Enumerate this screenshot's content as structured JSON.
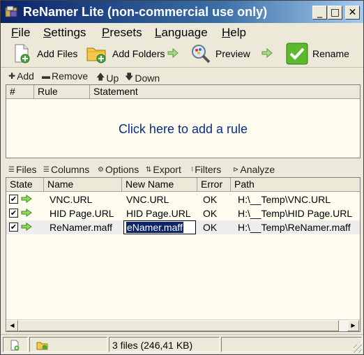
{
  "window": {
    "title": "ReNamer Lite (non-commercial use only)"
  },
  "menu": [
    "File",
    "Settings",
    "Presets",
    "Language",
    "Help"
  ],
  "menu_underline": [
    "F",
    "S",
    "P",
    "L",
    "H"
  ],
  "toolbar": {
    "add_files": "Add Files",
    "add_folders": "Add Folders",
    "preview": "Preview",
    "rename": "Rename"
  },
  "rules_toolbar": {
    "add": "Add",
    "remove": "Remove",
    "up": "Up",
    "down": "Down"
  },
  "rules_table": {
    "columns": [
      "#",
      "Rule",
      "Statement"
    ],
    "empty_hint": "Click here to add a rule"
  },
  "files_toolbar": {
    "files": "Files",
    "columns": "Columns",
    "options": "Options",
    "export": "Export",
    "filters": "Filters",
    "analyze": "Analyze"
  },
  "files_table": {
    "columns": [
      "State",
      "Name",
      "New Name",
      "Error",
      "Path"
    ],
    "rows": [
      {
        "checked": true,
        "name": "VNC.URL",
        "new_name": "VNC.URL",
        "error": "OK",
        "path": "H:\\__Temp\\VNC.URL"
      },
      {
        "checked": true,
        "name": "HID Page.URL",
        "new_name": "HID Page.URL",
        "error": "OK",
        "path": "H:\\__Temp\\HID Page.URL"
      },
      {
        "checked": true,
        "name": "ReNamer.maff",
        "new_name": "eNamer.maff",
        "error": "OK",
        "path": "H:\\__Temp\\ReNamer.maff"
      }
    ]
  },
  "status": {
    "summary": "3 files (246,41 KB)"
  },
  "colors": {
    "accent": "#0a246a",
    "panel_bg": "#fffdf0",
    "hint": "#0a2b8a",
    "arrow": "#5cb82c"
  }
}
